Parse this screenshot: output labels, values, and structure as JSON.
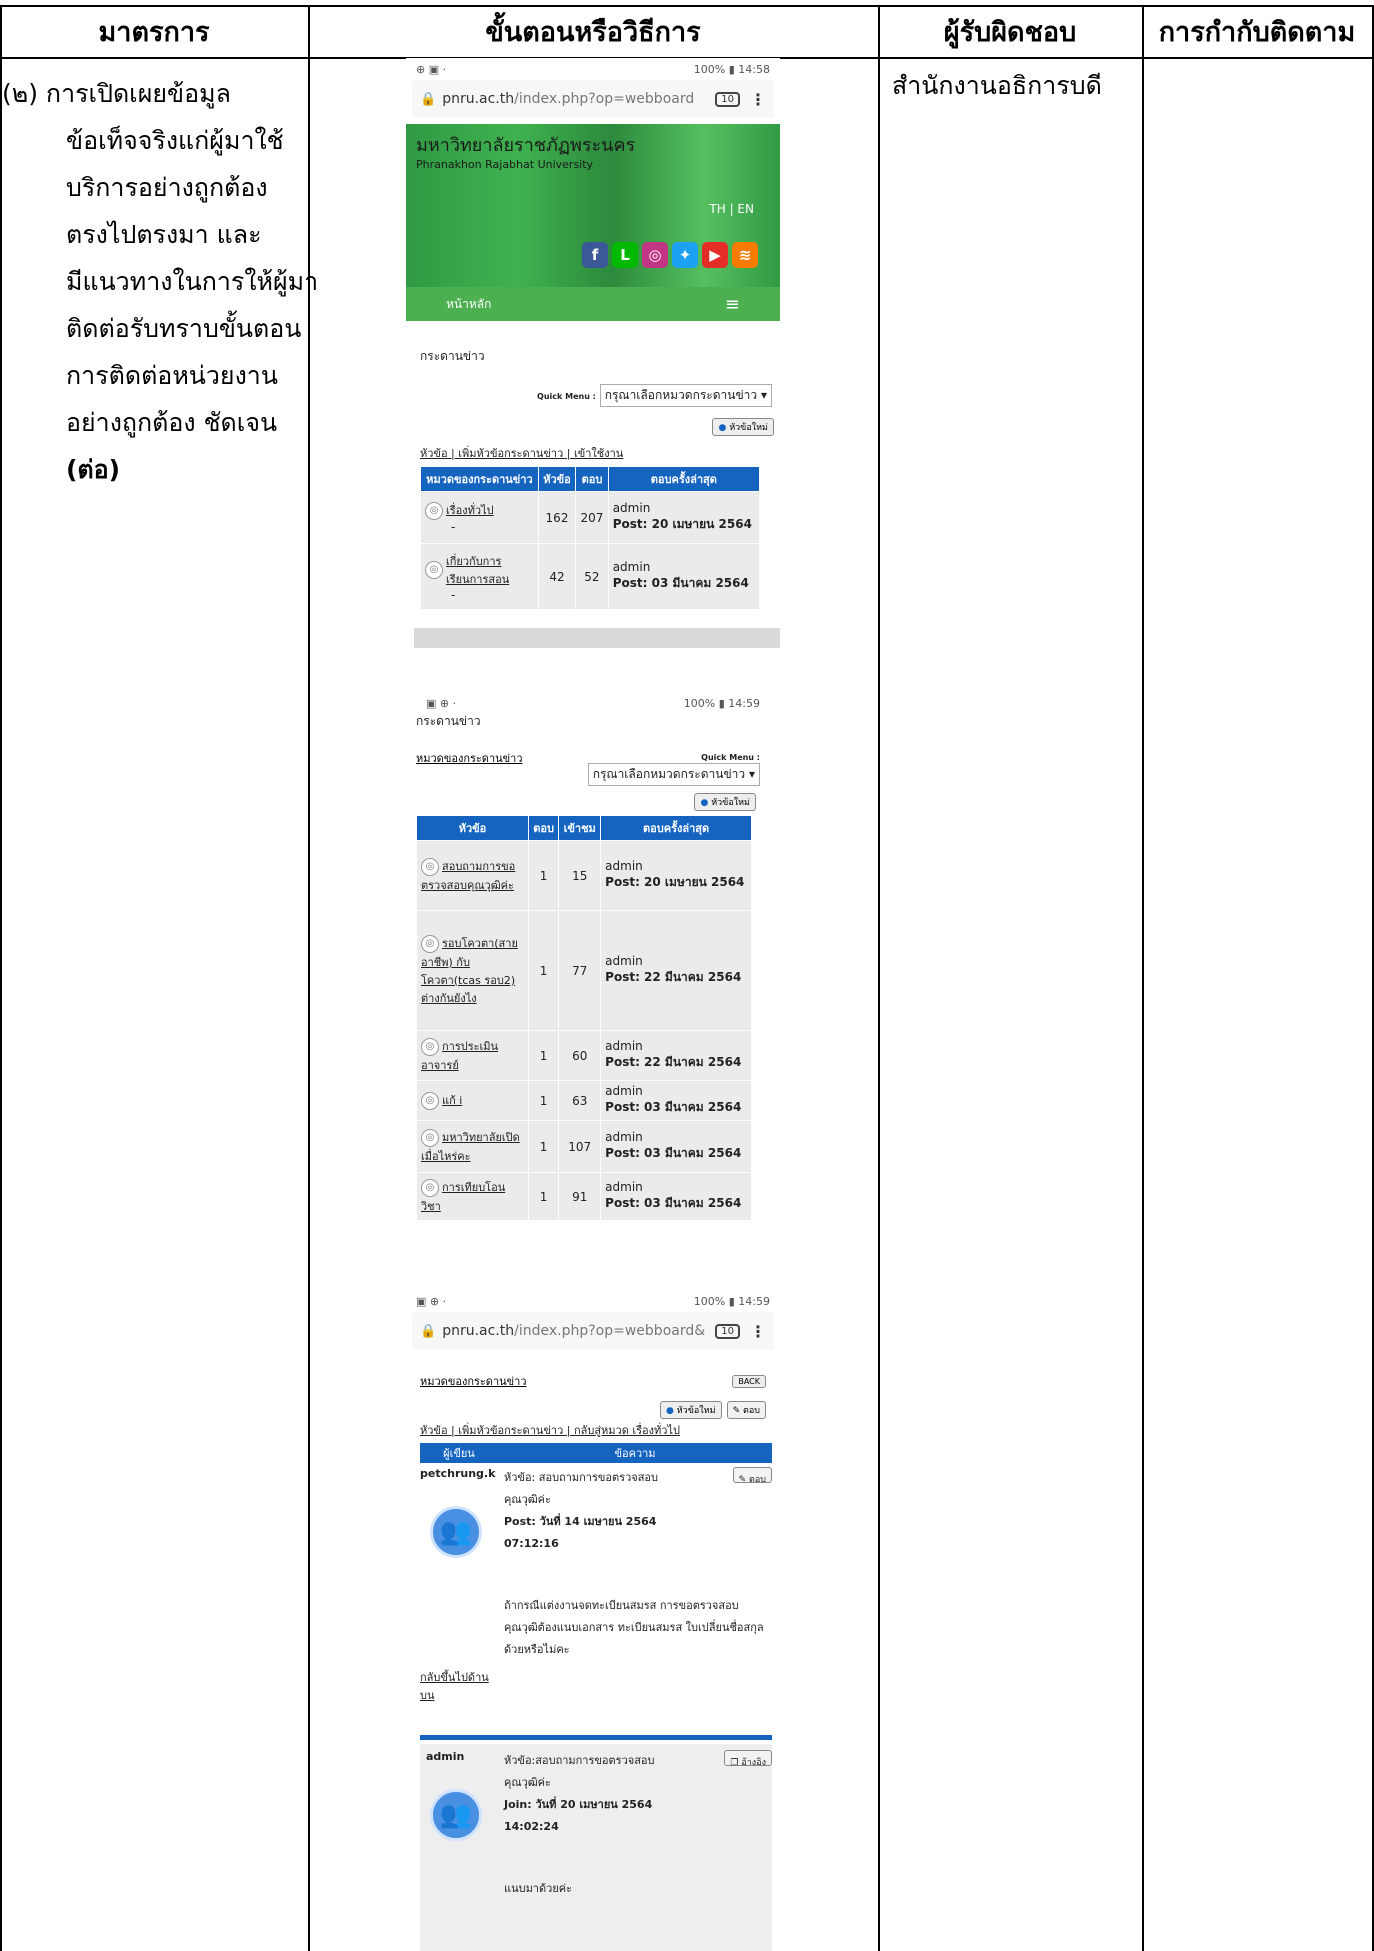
{
  "header": {
    "measure": "มาตรการ",
    "procedure": "ขั้นตอนหรือวิธีการ",
    "responsible": "ผู้รับผิดชอบ",
    "monitoring": "การกำกับติดตาม"
  },
  "measure_lines": [
    "(๒) การเปิดเผยข้อมูล",
    "ข้อเท็จจริงแก่ผู้มาใช้",
    "บริการอย่างถูกต้อง",
    "ตรงไปตรงมา และ",
    "มีแนวทางในการให้ผู้มา",
    "ติดต่อรับทราบขั้นตอน",
    "การติดต่อหน่วยงาน",
    "อย่างถูกต้อง ชัดเจน",
    "(ต่อ)"
  ],
  "responsible": "สำนักงานอธิการบดี",
  "shot1": {
    "status_time": "100% ▮ 14:58",
    "url_host": "pnru.ac.th",
    "url_path": "/index.php?op=webboard",
    "tab_count": "10",
    "univ_th": "มหาวิทยาลัยราชภัฏพระนคร",
    "univ_en": "Phranakhon Rajabhat University",
    "lang": "TH | EN",
    "nav_home": "หน้าหลัก",
    "page_title": "กระดานข่าว",
    "quick_menu_label": "Quick Menu :",
    "quick_menu_value": "กรุณาเลือกหมวดกระดานข่าว ▾",
    "new_topic": "หัวข้อใหม่",
    "links": "หัวข้อ | เพิ่มหัวข้อกระดานข่าว | เข้าใช้งาน",
    "cols": [
      "หมวดของกระดานข่าว",
      "หัวข้อ",
      "ตอบ",
      "ตอบครั้งล่าสุด"
    ],
    "rows": [
      {
        "name": "เรื่องทั่วไป",
        "sub": "-",
        "topics": "162",
        "replies": "207",
        "by": "admin",
        "post": "Post: 20 เมษายน 2564"
      },
      {
        "name": "เกี่ยวกับการเรียนการสอน",
        "sub": "-",
        "topics": "42",
        "replies": "52",
        "by": "admin",
        "post": "Post: 03 มีนาคม 2564"
      }
    ]
  },
  "shot2": {
    "status_time": "100% ▮ 14:59",
    "page_title": "กระดานข่าว",
    "crumb": "หมวดของกระดานข่าว",
    "quick_menu_label": "Quick Menu :",
    "quick_menu_value": "กรุณาเลือกหมวดกระดานข่าว ▾",
    "new_topic": "หัวข้อใหม่",
    "cols": [
      "หัวข้อ",
      "ตอบ",
      "เข้าชม",
      "ตอบครั้งล่าสุด"
    ],
    "rows": [
      {
        "topic": "สอบถามการขอตรวจสอบคุณวุฒิค่ะ",
        "replies": "1",
        "views": "15",
        "by": "admin",
        "post": "Post: 20 เมษายน 2564"
      },
      {
        "topic": "รอบโควตา(สายอาชีพ) กับโควตา(tcas รอบ2) ต่างกันยังไง",
        "replies": "1",
        "views": "77",
        "by": "admin",
        "post": "Post: 22 มีนาคม 2564"
      },
      {
        "topic": "การประเมินอาจารย์",
        "replies": "1",
        "views": "60",
        "by": "admin",
        "post": "Post: 22 มีนาคม 2564"
      },
      {
        "topic": "แก้ i",
        "replies": "1",
        "views": "63",
        "by": "admin",
        "post": "Post: 03 มีนาคม 2564"
      },
      {
        "topic": "มหาวิทยาลัยเปิดเมื่อไหร่คะ",
        "replies": "1",
        "views": "107",
        "by": "admin",
        "post": "Post: 03 มีนาคม 2564"
      },
      {
        "topic": "การเทียบโอนวิชา",
        "replies": "1",
        "views": "91",
        "by": "admin",
        "post": "Post: 03 มีนาคม 2564"
      }
    ]
  },
  "shot3": {
    "status_time": "100% ▮ 14:59",
    "url_host": "pnru.ac.th",
    "url_path": "/index.php?op=webboard&",
    "tab_count": "10",
    "crumb": "หมวดของกระดานข่าว",
    "back": "BACK",
    "new_topic": "หัวข้อใหม่",
    "reply": "ตอบ",
    "links": "หัวข้อ | เพิ่มหัวข้อกระดานข่าว | กลับสู่หมวด เรื่องทั่วไป",
    "cols": [
      "ผู้เขียน",
      "ข้อความ"
    ],
    "post1": {
      "author": "petchrung.k",
      "topic": "หัวข้อ: สอบถามการขอตรวจสอบคุณวุฒิค่ะ",
      "date": "Post: วันที่ 14 เมษายน 2564 07:12:16",
      "body": "ถ้ากรณีแต่งงานจดทะเบียนสมรส การขอตรวจสอบคุณวุฒิต้องแนบเอกสาร ทะเบียนสมรส ใบเปลี่ยนชื่อสกุลด้วยหรือไม่คะ",
      "back_to_top": "กลับขึ้นไปด้านบน"
    },
    "post2": {
      "author": "admin",
      "topic": "หัวข้อ:สอบถามการขอตรวจสอบคุณวุฒิค่ะ",
      "date": "Join: วันที่ 20 เมษายน 2564 14:02:24",
      "body": "แนบมาด้วยค่ะ",
      "quote": "อ้างอิง"
    }
  }
}
